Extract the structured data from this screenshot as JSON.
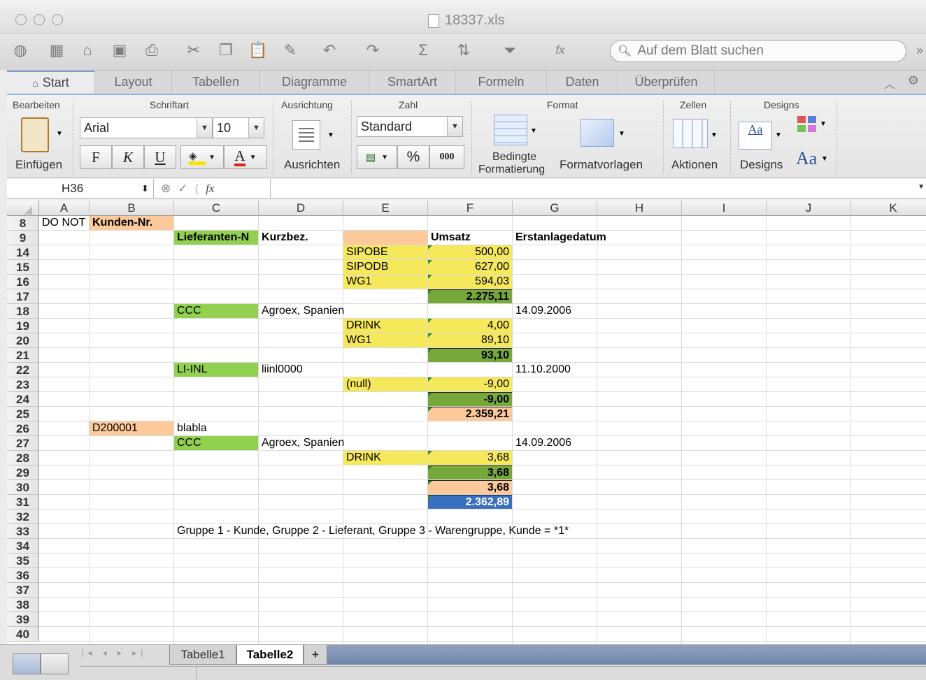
{
  "window": {
    "title": "18337.xls"
  },
  "search": {
    "placeholder": "Auf dem Blatt suchen"
  },
  "tabs": [
    "Start",
    "Layout",
    "Tabellen",
    "Diagramme",
    "SmartArt",
    "Formeln",
    "Daten",
    "Überprüfen"
  ],
  "ribbon": {
    "groups": {
      "edit": "Bearbeiten",
      "font": "Schriftart",
      "align": "Ausrichtung",
      "number": "Zahl",
      "format": "Format",
      "cells": "Zellen",
      "designs": "Designs"
    },
    "paste_label": "Einfügen",
    "font_name": "Arial",
    "font_size": "10",
    "bold": "F",
    "italic": "K",
    "underline": "U",
    "font_color_letter": "A",
    "align_label": "Ausrichten",
    "number_format": "Standard",
    "percent": "%",
    "thousands": "000",
    "cond_format_1": "Bedingte",
    "cond_format_2": "Formatierung",
    "format_templates": "Formatvorlagen",
    "actions": "Aktionen",
    "designs_label": "Designs",
    "aa_small": "Aa",
    "aa_large": "Aa"
  },
  "formula_bar": {
    "cell_ref": "H36",
    "fx": "fx"
  },
  "columns": [
    "A",
    "B",
    "C",
    "D",
    "E",
    "F",
    "G",
    "H",
    "I",
    "J",
    "K"
  ],
  "rows": [
    "8",
    "9",
    "14",
    "15",
    "16",
    "17",
    "18",
    "19",
    "20",
    "21",
    "22",
    "23",
    "24",
    "25",
    "26",
    "27",
    "28",
    "29",
    "30",
    "31",
    "32",
    "33",
    "34",
    "35",
    "36",
    "37",
    "38",
    "39",
    "40"
  ],
  "cells": {
    "a8": "DO NOT",
    "b8": "Kunden-Nr.",
    "c9": "Lieferanten-N",
    "d9": "Kurzbez.",
    "f9": "Umsatz",
    "g9": "Erstanlagedatum",
    "e14": "SIPOBE",
    "f14": "500,00",
    "e15": "SIPODB",
    "f15": "627,00",
    "e16": "WG1",
    "f16": "594,03",
    "f17": "2.275,11",
    "c18": "CCC",
    "d18": "Agroex, Spanien",
    "g18": "14.09.2006",
    "e19": "DRINK",
    "f19": "4,00",
    "e20": "WG1",
    "f20": "89,10",
    "f21": "93,10",
    "c22": "LI-INL",
    "d22": "liinl0000",
    "g22": "11.10.2000",
    "e23": "(null)",
    "f23": "-9,00",
    "f24": "-9,00",
    "f25": "2.359,21",
    "b26": "D200001",
    "c26": "blabla",
    "c27": "CCC",
    "d27": "Agroex, Spanien",
    "g27": "14.09.2006",
    "e28": "DRINK",
    "f28": "3,68",
    "f29": "3,68",
    "f30": "3,68",
    "f31": "2.362,89",
    "c33": "Gruppe 1 - Kunde, Gruppe 2 - Lieferant, Gruppe 3 - Warengruppe, Kunde = *1*"
  },
  "sheets": [
    "Tabelle1",
    "Tabelle2"
  ],
  "add_sheet": "+",
  "colors": {
    "orange": "#fdc99a",
    "green": "#92d050",
    "yellow": "#f5e85a",
    "darkgreen": "#77a83a",
    "blue": "#3a6fc0"
  }
}
